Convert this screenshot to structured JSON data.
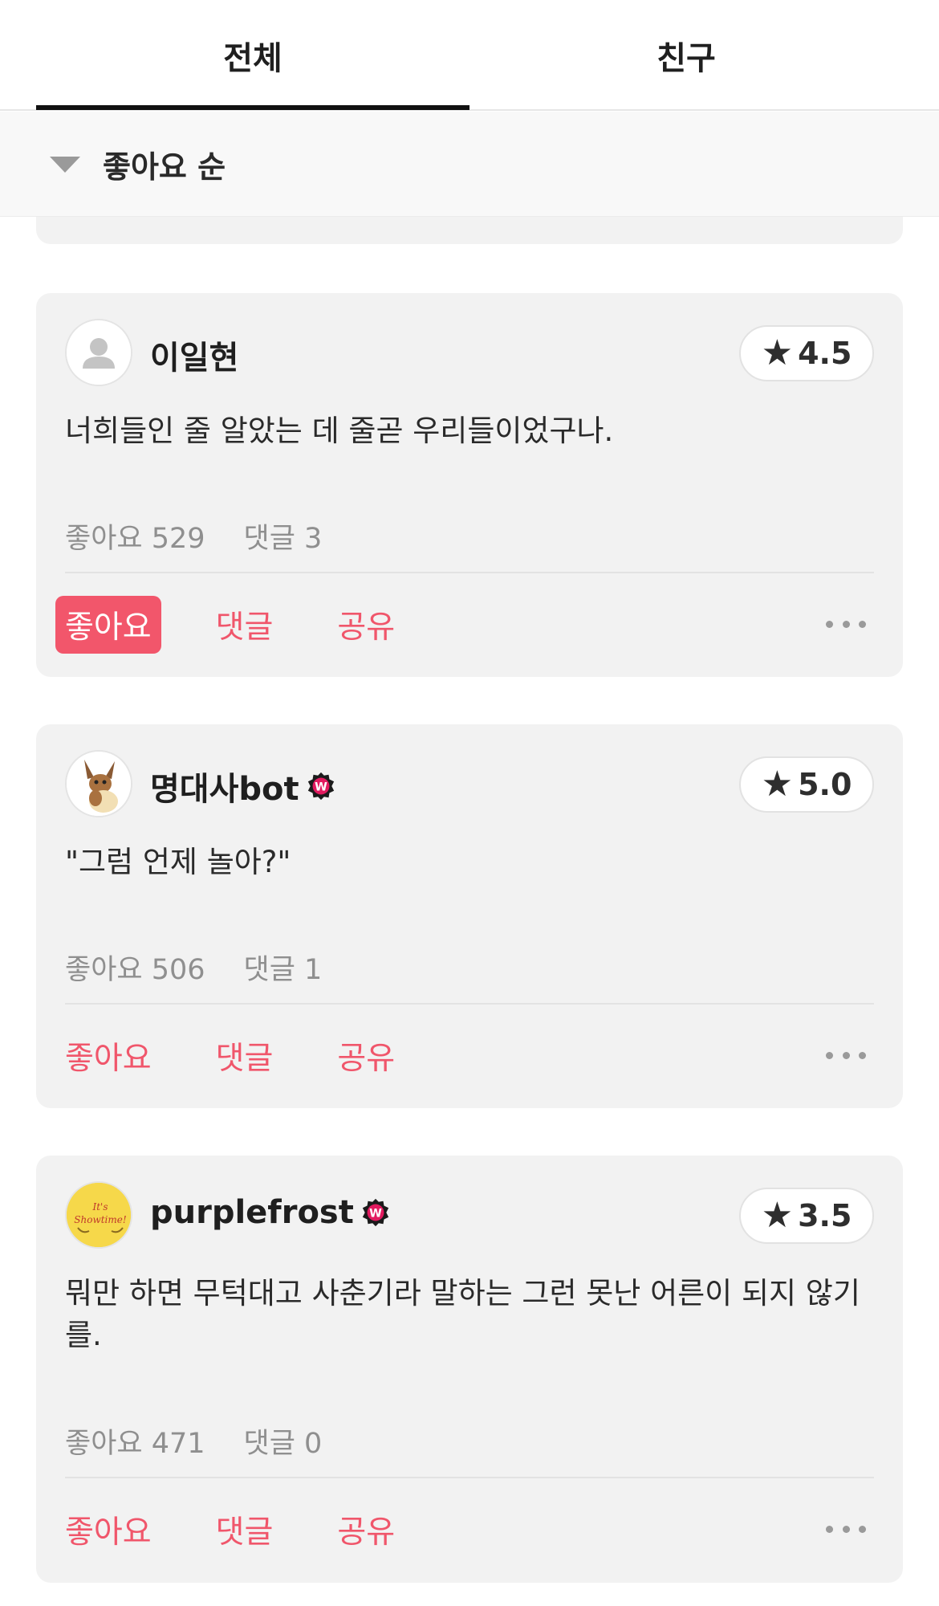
{
  "tabs": [
    {
      "label": "전체",
      "active": true
    },
    {
      "label": "친구",
      "active": false
    }
  ],
  "sort": {
    "label": "좋아요 순"
  },
  "reviews": [
    {
      "username": "이일현",
      "verified": false,
      "rating": "4.5",
      "text": "너희들인 줄 알았는 데 줄곧 우리들이었구나.",
      "likes_label": "좋아요 529",
      "comments_label": "댓글 3",
      "actions": {
        "like": "좋아요",
        "comment": "댓글",
        "share": "공유"
      },
      "liked": true
    },
    {
      "username": "명대사bot",
      "verified": true,
      "rating": "5.0",
      "text": "\"그럼 언제 놀아?\"",
      "likes_label": "좋아요 506",
      "comments_label": "댓글 1",
      "actions": {
        "like": "좋아요",
        "comment": "댓글",
        "share": "공유"
      },
      "liked": false
    },
    {
      "username": "purplefrost",
      "verified": true,
      "rating": "3.5",
      "text": "뭐만 하면 무턱대고 사춘기라 말하는 그런 못난 어른이 되지 않기를.",
      "likes_label": "좋아요 471",
      "comments_label": "댓글 0",
      "actions": {
        "like": "좋아요",
        "comment": "댓글",
        "share": "공유"
      },
      "liked": false
    }
  ],
  "colors": {
    "accent": "#f2566b",
    "card_bg": "#f2f2f2",
    "badge": "#e21a5f"
  }
}
